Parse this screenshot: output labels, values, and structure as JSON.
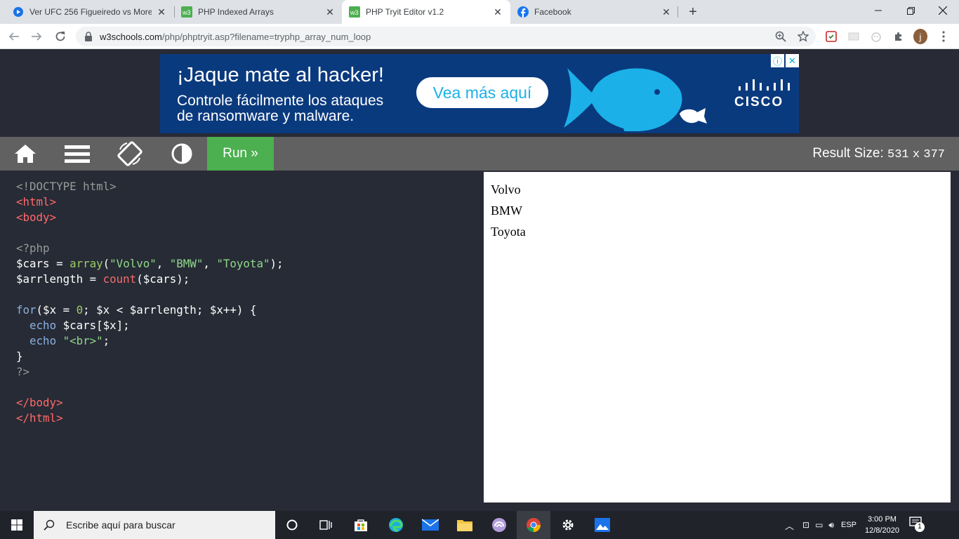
{
  "browser": {
    "tabs": [
      {
        "title": "Ver UFC 256 Figueiredo vs Moren",
        "favicon": "play-icon"
      },
      {
        "title": "PHP Indexed Arrays",
        "favicon": "w3schools-icon"
      },
      {
        "title": "PHP Tryit Editor v1.2",
        "favicon": "w3schools-icon"
      },
      {
        "title": "Facebook",
        "favicon": "facebook-icon"
      }
    ],
    "url_host": "w3schools.com",
    "url_path": "/php/phptryit.asp?filename=tryphp_array_num_loop",
    "profile_initial": "j"
  },
  "ad": {
    "headline": "¡Jaque mate al hacker!",
    "body_line1": "Controle fácilmente los ataques",
    "body_line2": "de ransomware y malware.",
    "cta": "Vea más aquí",
    "brand": "CISCO",
    "colors": {
      "bg": "#0A3A7E",
      "fish": "#1BB0E8"
    }
  },
  "editor": {
    "run_label": "Run »",
    "result_size_label": "Result Size:",
    "result_width": "531",
    "result_x": "x",
    "result_height": "377",
    "run_color": "#4CAF50",
    "code_lines": [
      "<!DOCTYPE html>",
      "<html>",
      "<body>",
      "",
      "<?php",
      "$cars = array(\"Volvo\", \"BMW\", \"Toyota\");",
      "$arrlength = count($cars);",
      "",
      "for($x = 0; $x < $arrlength; $x++) {",
      "  echo $cars[$x];",
      "  echo \"<br>\";",
      "}",
      "?>",
      "",
      "</body>",
      "</html>"
    ],
    "result_lines": [
      "Volvo",
      "BMW",
      "Toyota"
    ]
  },
  "taskbar": {
    "search_placeholder": "Escribe aquí para buscar",
    "language": "ESP",
    "time": "3:00 PM",
    "date": "12/8/2020",
    "notification_count": "1"
  }
}
